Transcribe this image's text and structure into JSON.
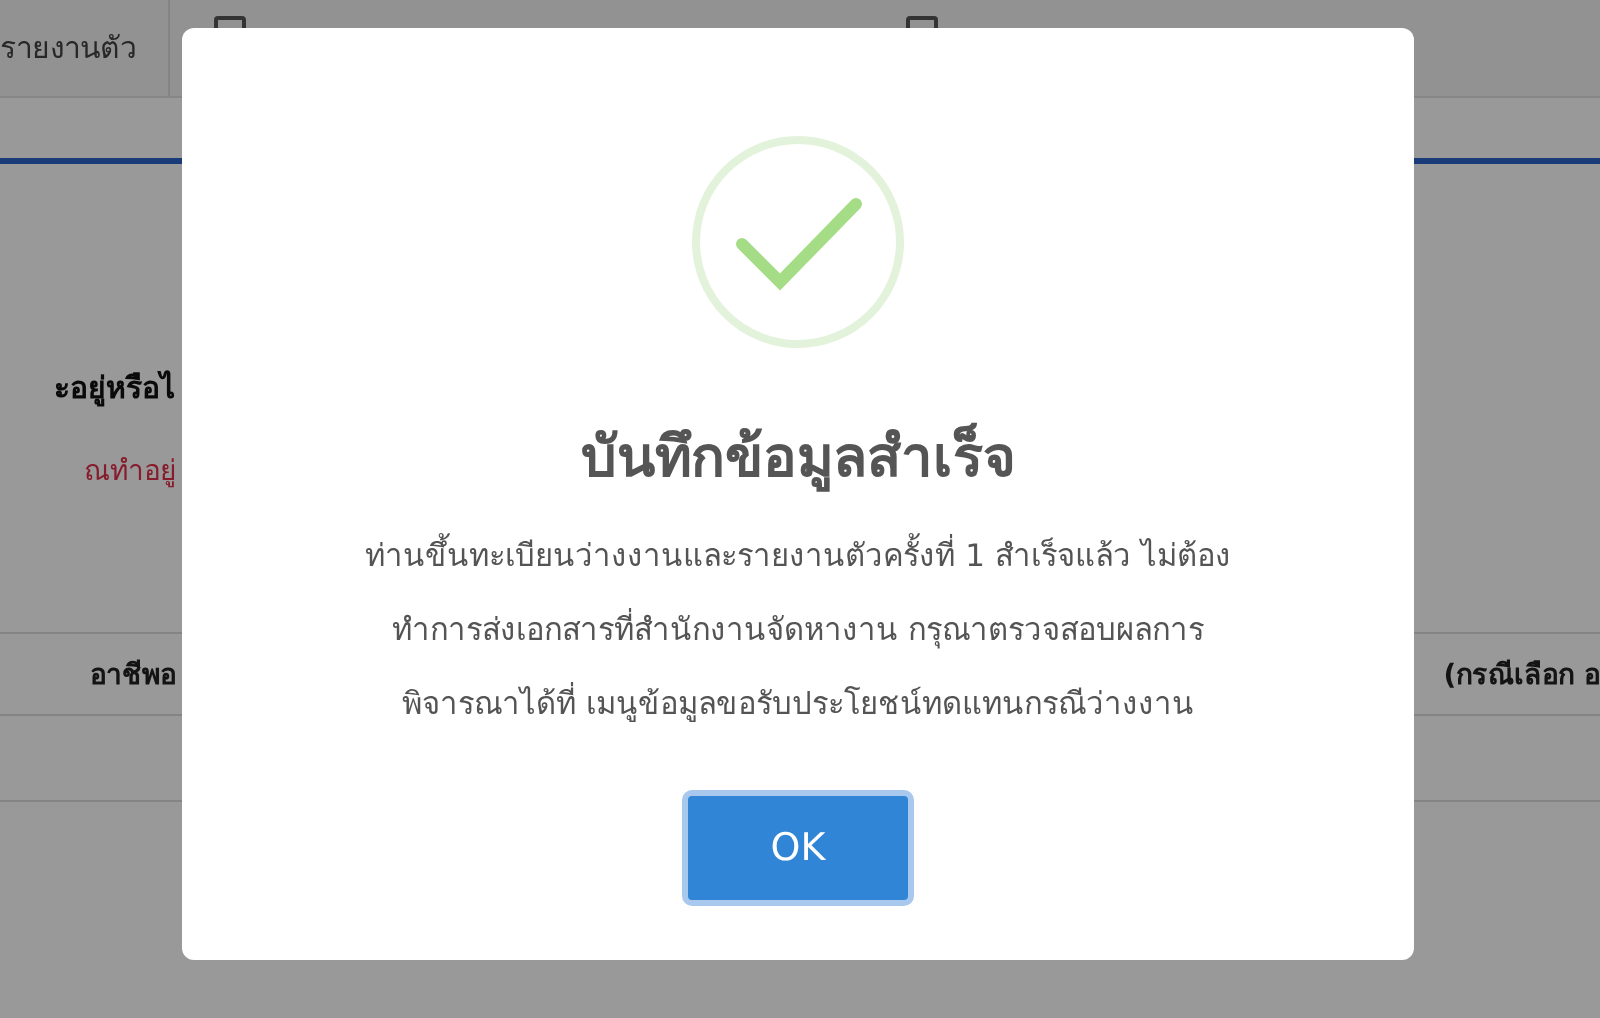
{
  "background_page": {
    "tab_label": "รายงานตัว",
    "question": "ะอยู่หรือไ",
    "note": "ณทำอยู่",
    "table": {
      "columns": [
        "อาชีพอ",
        "(กรณีเลือก อ"
      ]
    }
  },
  "dialog": {
    "title": "บันทึกข้อมูลสำเร็จ",
    "message": "ท่านขึ้นทะเบียนว่างงานและรายงานตัวครั้งที่ 1 สำเร็จแล้ว ไม่ต้อง\nทำการส่งเอกสารที่สำนักงานจัดหางาน กรุณาตรวจสอบผลการ\nพิจารณาได้ที่ เมนูข้อมูลขอรับประโยชน์ทดแทนกรณีว่างงาน",
    "buttons": [
      "OK"
    ]
  }
}
